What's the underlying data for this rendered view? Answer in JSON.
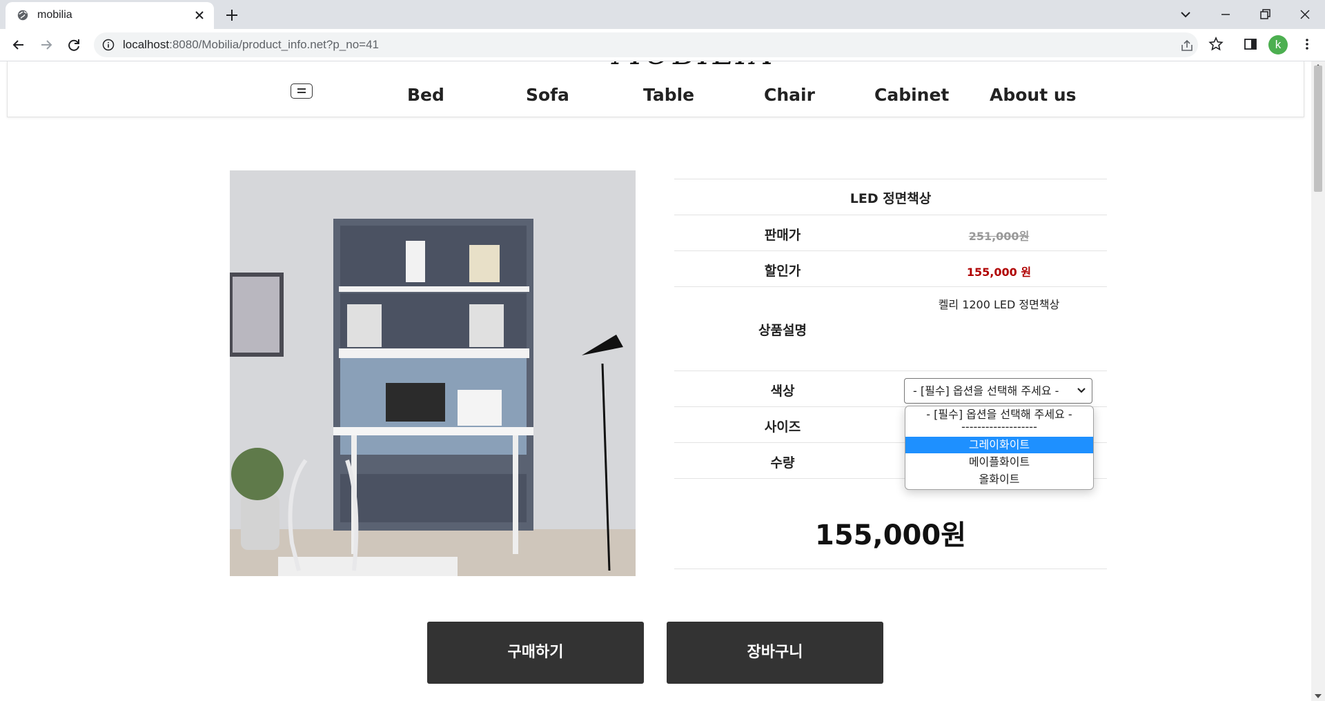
{
  "browser": {
    "tab_title": "mobilia",
    "url_host": "localhost",
    "url_rest": ":8080/Mobilia/product_info.net?p_no=41",
    "profile_initial": "k"
  },
  "site": {
    "logo": "MOBILIA",
    "nav": [
      "Bed",
      "Sofa",
      "Table",
      "Chair",
      "Cabinet",
      "About us"
    ]
  },
  "product": {
    "name": "LED 정면책상",
    "price_label": "판매가",
    "price_value": "251,000원",
    "sale_label": "할인가",
    "sale_value": "155,000 원",
    "desc_label": "상품설명",
    "desc_value": "켈리 1200 LED 정면책상",
    "color_label": "색상",
    "size_label": "사이즈",
    "qty_label": "수량",
    "total": "155,000원"
  },
  "color_select": {
    "selected": "- [필수] 옵션을 선택해 주세요 -",
    "options": [
      "- [필수] 옵션을 선택해 주세요 -",
      "-------------------",
      "그레이화이트",
      "메이플화이트",
      "올화이트"
    ],
    "highlighted_index": 2
  },
  "buttons": {
    "buy": "구매하기",
    "cart": "장바구니"
  },
  "colors": {
    "sale": "#b00000",
    "button": "#333333",
    "highlight": "#1e90ff"
  }
}
